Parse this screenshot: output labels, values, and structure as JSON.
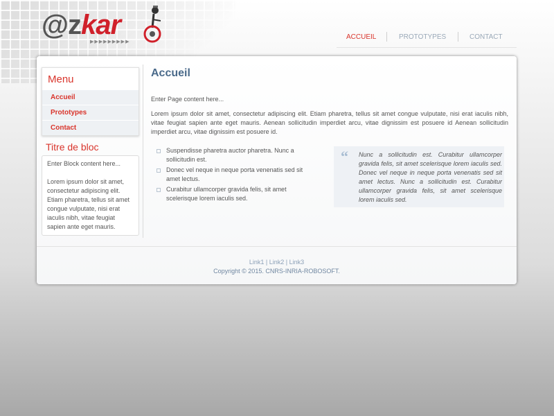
{
  "logo": {
    "at": "@",
    "z": "z",
    "kar": "kar",
    "arrows": "▶▶▶▶▶▶▶▶▶"
  },
  "nav": {
    "items": [
      {
        "label": "ACCUEIL",
        "active": true
      },
      {
        "label": "PROTOTYPES",
        "active": false
      },
      {
        "label": "CONTACT",
        "active": false
      }
    ]
  },
  "sidebar": {
    "menu_title": "Menu",
    "menu_items": [
      "Accueil",
      "Prototypes",
      "Contact"
    ],
    "block_title": "Titre de bloc",
    "block_intro": "Enter Block content here...",
    "block_text": "Lorem ipsum dolor sit amet, consectetur adipiscing elit. Etiam pharetra, tellus sit amet congue vulputate, nisi erat iaculis nibh, vitae feugiat sapien ante eget mauris."
  },
  "main": {
    "title": "Accueil",
    "intro": "Enter Page content here...",
    "paragraph": "Lorem ipsum dolor sit amet, consectetur adipiscing elit. Etiam pharetra, tellus sit amet congue vulputate, nisi erat iaculis nibh, vitae feugiat sapien ante eget mauris. Aenean sollicitudin imperdiet arcu, vitae dignissim est posuere id Aenean sollicitudin imperdiet arcu, vitae dignissim est posuere id.",
    "list": [
      "Suspendisse pharetra auctor pharetra. Nunc a sollicitudin est.",
      "Donec vel neque in neque porta venenatis sed sit amet lectus.",
      "Curabitur ullamcorper gravida felis, sit amet scelerisque lorem iaculis sed."
    ],
    "quote_mark": "“",
    "quote": "Nunc a sollicitudin est. Curabitur ullamcorper gravida felis, sit amet scelerisque lorem iaculis sed. Donec vel neque in neque porta venenatis sed sit amet lectus. Nunc a sollicitudin est. Curabitur ullamcorper gravida felis, sit amet scelerisque lorem iaculis sed."
  },
  "footer": {
    "links": [
      "Link1",
      "Link2",
      "Link3"
    ],
    "separator": "|",
    "copyright": "Copyright © 2015. CNRS-INRIA-ROBOSOFT."
  },
  "colors": {
    "accent": "#d9342b",
    "title_blue": "#4a6a8a",
    "link_blue": "#8a9fb6"
  }
}
